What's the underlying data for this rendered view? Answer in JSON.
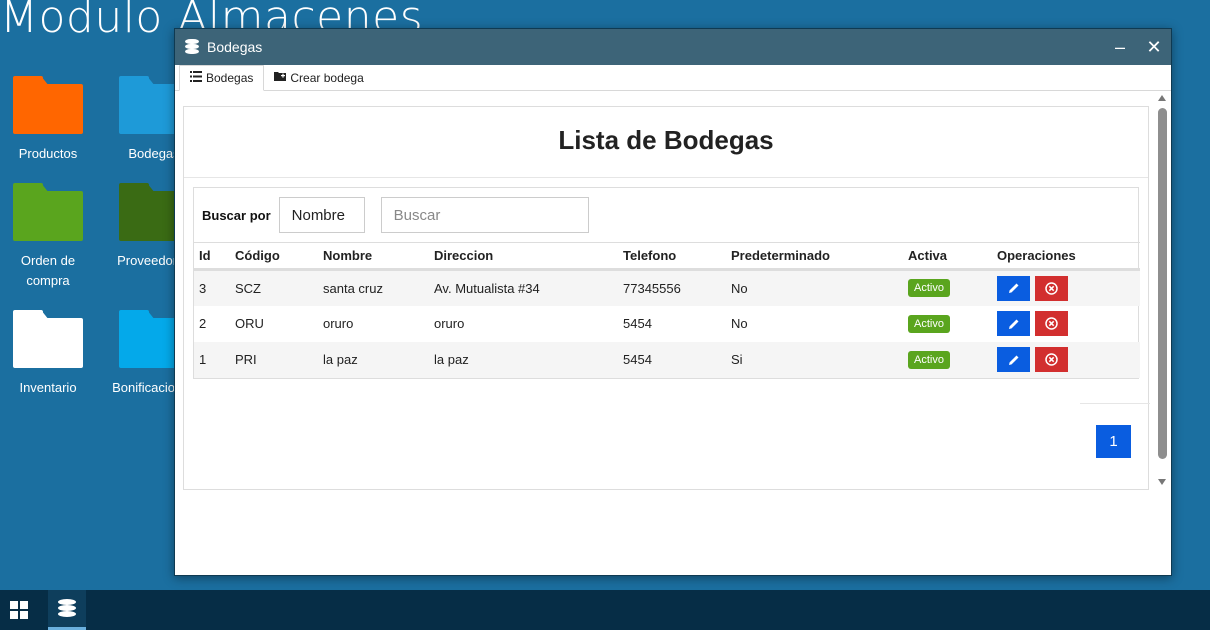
{
  "desktop": {
    "title": "Modulo Almacenes",
    "icons": [
      {
        "label": "Productos",
        "color": "#ff6600"
      },
      {
        "label": "Bodegas",
        "color": "#1e9ad8"
      },
      {
        "label": "Orden de compra",
        "color": "#5aa51e"
      },
      {
        "label": "Proveedores",
        "color": "#3a6b14"
      },
      {
        "label": "Inventario",
        "color": "#ffffff"
      },
      {
        "label": "Bonificaciones",
        "color": "#04a9ea"
      }
    ]
  },
  "window": {
    "title": "Bodegas",
    "minimize_glyph": "‒",
    "close_glyph": "✕",
    "tabs": [
      {
        "label": "Bodegas",
        "icon": "list-icon"
      },
      {
        "label": "Crear bodega",
        "icon": "folder-plus-icon"
      }
    ]
  },
  "page": {
    "heading": "Lista de Bodegas",
    "search": {
      "label": "Buscar por",
      "field": "Nombre",
      "placeholder": "Buscar"
    },
    "table": {
      "columns": [
        "Id",
        "Código",
        "Nombre",
        "Direccion",
        "Telefono",
        "Predeterminado",
        "Activa",
        "Operaciones"
      ],
      "rows": [
        {
          "id": "3",
          "codigo": "SCZ",
          "nombre": "santa cruz",
          "direccion": "Av. Mutualista #34",
          "telefono": "77345556",
          "predeterminado": "No",
          "activa": "Activo"
        },
        {
          "id": "2",
          "codigo": "ORU",
          "nombre": "oruro",
          "direccion": "oruro",
          "telefono": "5454",
          "predeterminado": "No",
          "activa": "Activo"
        },
        {
          "id": "1",
          "codigo": "PRI",
          "nombre": "la paz",
          "direccion": "la paz",
          "telefono": "5454",
          "predeterminado": "Si",
          "activa": "Activo"
        }
      ]
    },
    "pagination": {
      "current": "1"
    }
  },
  "colors": {
    "desktop_bg": "#1b6fa0",
    "titlebar": "#3d6478",
    "primary": "#0a5de0",
    "danger": "#d22f2f",
    "success": "#5aa51e",
    "taskbar": "#062d46"
  }
}
